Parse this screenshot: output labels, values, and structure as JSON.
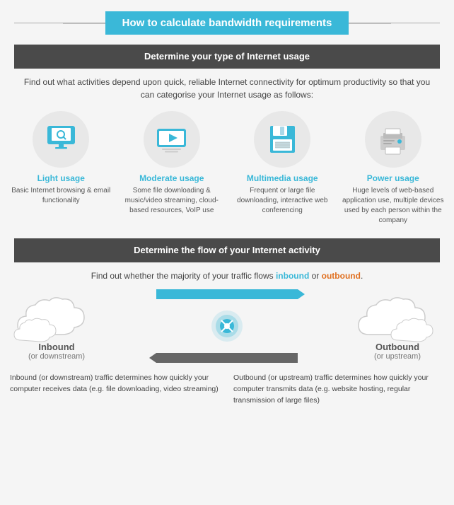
{
  "title": "How to calculate bandwidth requirements",
  "section1": {
    "header": "Determine your type of Internet usage",
    "intro": "Find out what activities depend upon quick, reliable Internet connectivity for optimum productivity so that you can categorise your Internet usage as follows:",
    "cards": [
      {
        "id": "light",
        "title": "Light usage",
        "desc": "Basic Internet browsing & email functionality",
        "icon": "monitor"
      },
      {
        "id": "moderate",
        "title": "Moderate usage",
        "desc": "Some file downloading & music/video streaming, cloud-based resources, VoIP use",
        "icon": "play"
      },
      {
        "id": "multimedia",
        "title": "Multimedia usage",
        "desc": "Frequent or large file downloading, interactive web conferencing",
        "icon": "floppy"
      },
      {
        "id": "power",
        "title": "Power usage",
        "desc": "Huge levels of web-based application use, multiple devices used by each person within the company",
        "icon": "printer"
      }
    ]
  },
  "section2": {
    "header": "Determine the flow of your Internet activity",
    "intro_prefix": "Find out whether the majority of your traffic flows ",
    "inbound_label": "inbound",
    "outbound_label": "outbound",
    "intro_suffix": " or ",
    "intro_end": ".",
    "inbound": {
      "label": "Inbound",
      "sub": "(or downstream)"
    },
    "outbound": {
      "label": "Outbound",
      "sub": "(or upstream)"
    },
    "bottom_left": "Inbound (or downstream) traffic determines how quickly your computer receives data (e.g. file downloading, video streaming)",
    "bottom_right": "Outbound (or upstream) traffic determines how quickly your computer transmits data (e.g. website hosting, regular transmission of large files)"
  }
}
